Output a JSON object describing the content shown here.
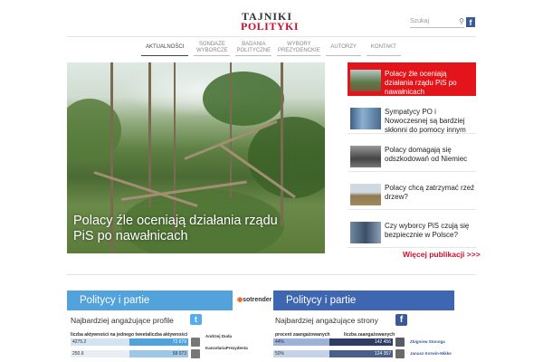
{
  "header": {
    "logo_line1": "TAJNIKI",
    "logo_line2": "POLITYKI",
    "search_placeholder": "Szukaj",
    "search_icon": "magnifier-icon",
    "facebook_icon": "facebook-icon"
  },
  "nav": [
    {
      "label": "AKTUALNOŚCI",
      "active": true
    },
    {
      "label": "SONDAŻE WYBORCZE",
      "active": false
    },
    {
      "label": "BADANIA POLITYCZNE",
      "active": false
    },
    {
      "label": "WYBORY PREZYDENCKIE",
      "active": false
    },
    {
      "label": "AUTORZY",
      "active": false
    },
    {
      "label": "KONTAKT",
      "active": false
    }
  ],
  "hero": {
    "caption": "Polacy źle oceniają działania rządu PiS po nawałnicach"
  },
  "side_articles": [
    {
      "title": "Polacy źle oceniają działania rządu PiS po nawałnicach",
      "featured": true
    },
    {
      "title": "Sympatycy PO i Nowoczesnej są bardziej skłonni do pomocy innym",
      "featured": false
    },
    {
      "title": "Polacy domagają się odszkodowań od Niemiec",
      "featured": false
    },
    {
      "title": "Polacy chcą zatrzymać rzeź drzew?",
      "featured": false
    },
    {
      "title": "Czy wyborcy PiS czują się bezpiecznie w Polsce?",
      "featured": false
    }
  ],
  "more_link": "Więcej publikacji >>>",
  "panel_left": {
    "title": "Politycy i partie",
    "brand": "sotrender",
    "subtitle": "Najbardziej angażujące profile",
    "icon": "twitter-icon",
    "col1": "liczba aktywności na jednego tweeta",
    "col2": "liczba aktywności",
    "rows": [
      {
        "v1": "4275.2",
        "v2": "72 679",
        "name": "Andrzej Duda"
      },
      {
        "v1": "250.6",
        "v2": "58 073",
        "name": "KancelariaPrezydenta"
      }
    ]
  },
  "panel_right": {
    "title": "Politycy i partie",
    "subtitle": "Najbardziej angażujące strony",
    "icon": "facebook-icon",
    "col1": "procent zaangażowanych",
    "col2": "liczba zaangażowanych",
    "rows": [
      {
        "v1": "44%",
        "v2": "142 456",
        "name": "Zbigniew Stonoga"
      },
      {
        "v1": "50%",
        "v2": "124 357",
        "name": "Janusz Korwin-Mikke"
      }
    ]
  }
}
